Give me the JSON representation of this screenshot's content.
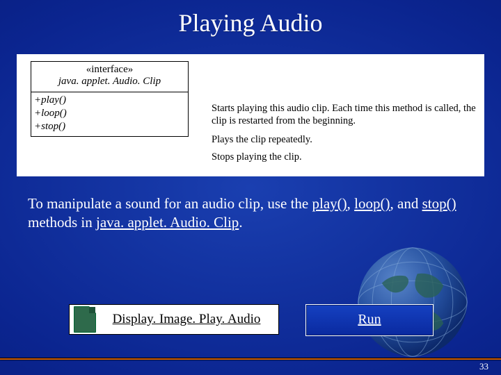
{
  "title": "Playing Audio",
  "uml": {
    "stereotype": "«interface»",
    "class_name": "java. applet. Audio. Clip",
    "methods": [
      "+play()",
      "+loop()",
      "+stop()"
    ]
  },
  "descriptions": {
    "play": "Starts playing this audio clip. Each time this method is called, the clip is restarted from the beginning.",
    "loop": "Plays the clip repeatedly.",
    "stop": "Stops playing the clip."
  },
  "body": {
    "pre": "To manipulate a sound for an audio clip, use the ",
    "play": "play()",
    "sep1": ", ",
    "loop": "loop()",
    "sep2": ", and ",
    "stop": "stop()",
    "mid": " methods in ",
    "cls": "java. applet. Audio. Clip",
    "post": "."
  },
  "buttons": {
    "file_label": "Display. Image. Play. Audio",
    "run_label": "Run"
  },
  "slide_number": "33"
}
